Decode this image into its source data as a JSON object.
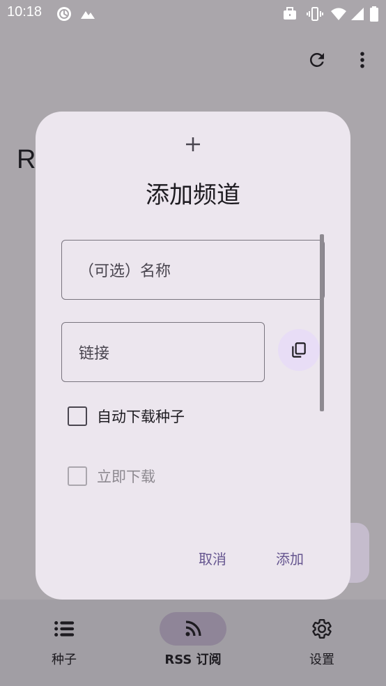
{
  "status_bar": {
    "time": "10:18"
  },
  "background": {
    "partial_heading": "R"
  },
  "dialog": {
    "title": "添加频道",
    "name_placeholder": "（可选）名称",
    "link_placeholder": "链接",
    "auto_download_label": "自动下载种子",
    "download_now_label": "立即下载",
    "cancel_label": "取消",
    "add_label": "添加"
  },
  "bottom_nav": {
    "items": [
      {
        "label": "种子"
      },
      {
        "label": "RSS 订阅"
      },
      {
        "label": "设置"
      }
    ]
  },
  "colors": {
    "accent": "#65558f",
    "dialog_surface": "#ece6ee",
    "scrim": "#aaa6ab"
  }
}
